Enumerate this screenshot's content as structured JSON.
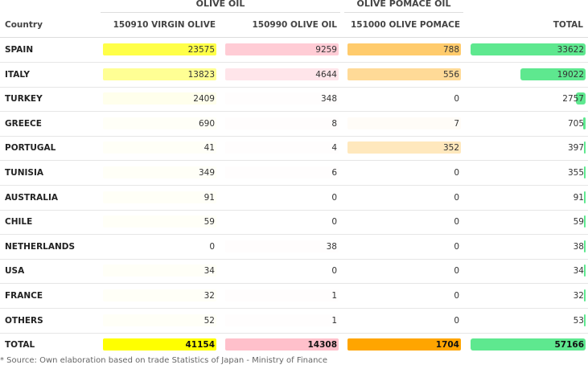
{
  "headers": {
    "group_olive_oil": "OLIVE OIL",
    "group_olive_pomace_oil": "OLIVE POMACE OIL",
    "country": "Country",
    "col1": "150910 VIRGIN OLIVE OIL",
    "col2": "150990 OLIVE OIL",
    "col3": "151000 OLIVE POMACE OIL",
    "total": "TOTAL"
  },
  "footer": "* Source: Own elaboration based on trade Statistics of Japan - Ministry of Finance",
  "colors": {
    "virgin": "#ffff00",
    "olive": "#ffc0cb",
    "pomace": "#ffa500",
    "total": "#5ee88f"
  },
  "chart_data": {
    "type": "table",
    "columns": [
      "150910 VIRGIN OLIVE OIL",
      "150990 OLIVE OIL",
      "151000 OLIVE POMACE OIL",
      "TOTAL"
    ],
    "rows": [
      {
        "country": "SPAIN",
        "values": [
          23575,
          9259,
          788,
          33622
        ]
      },
      {
        "country": "ITALY",
        "values": [
          13823,
          4644,
          556,
          19022
        ]
      },
      {
        "country": "TURKEY",
        "values": [
          2409,
          348,
          0,
          2757
        ]
      },
      {
        "country": "GREECE",
        "values": [
          690,
          8,
          7,
          705
        ]
      },
      {
        "country": "PORTUGAL",
        "values": [
          41,
          4,
          352,
          397
        ]
      },
      {
        "country": "TUNISIA",
        "values": [
          349,
          6,
          0,
          355
        ]
      },
      {
        "country": "AUSTRALIA",
        "values": [
          91,
          0,
          0,
          91
        ]
      },
      {
        "country": "CHILE",
        "values": [
          59,
          0,
          0,
          59
        ]
      },
      {
        "country": "NETHERLANDS",
        "values": [
          0,
          38,
          0,
          38
        ]
      },
      {
        "country": "USA",
        "values": [
          34,
          0,
          0,
          34
        ]
      },
      {
        "country": "FRANCE",
        "values": [
          32,
          1,
          0,
          32
        ]
      },
      {
        "country": "OTHERS",
        "values": [
          52,
          1,
          0,
          53
        ]
      }
    ],
    "total_row": {
      "country": "TOTAL",
      "values": [
        41154,
        14308,
        1704,
        57166
      ]
    }
  }
}
